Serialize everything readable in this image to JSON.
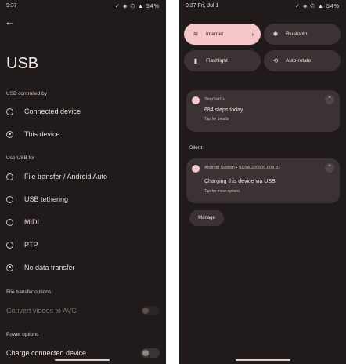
{
  "left_panel": {
    "status_time": "9:37",
    "status_icons": "✓ ◈ ✆ ▲ 54%",
    "back_icon": "arrow-back-icon",
    "page_title": "USB",
    "usb_controlled_by_heading": "USB controlled by",
    "controlled_options": [
      {
        "label": "Connected device",
        "selected": false
      },
      {
        "label": "This device",
        "selected": true
      }
    ],
    "use_usb_for_heading": "Use USB for",
    "usb_for_options": [
      {
        "label": "File transfer / Android Auto",
        "selected": false
      },
      {
        "label": "USB tethering",
        "selected": false
      },
      {
        "label": "MIDI",
        "selected": false
      },
      {
        "label": "PTP",
        "selected": false
      },
      {
        "label": "No data transfer",
        "selected": true
      }
    ],
    "file_transfer_options_heading": "File transfer options",
    "convert_videos_label": "Convert videos to AVC",
    "convert_videos_enabled": false,
    "power_options_heading": "Power options",
    "charge_connected_device_label": "Charge connected device",
    "charge_connected_device_on": false
  },
  "right_panel": {
    "status_time": "9:37 Fri, Jul 1",
    "status_icons": "✓ ◈ ✆ ▲ 54%",
    "tiles": [
      {
        "label": "Internet",
        "icon": "wifi-icon",
        "active": true,
        "has_chevron": true
      },
      {
        "label": "Bluetooth",
        "icon": "bluetooth-icon",
        "active": false
      },
      {
        "label": "Flashlight",
        "icon": "flashlight-icon",
        "active": false
      },
      {
        "label": "Auto-rotate",
        "icon": "auto-rotate-icon",
        "active": false
      }
    ],
    "notifications": {
      "stepsetgo": {
        "app": "StepSetGo",
        "title": "684 steps today",
        "subtitle": "Tap for details"
      },
      "silent_label": "Silent",
      "android_system": {
        "app": "Android System • SQ3A.220605.009.B1",
        "title": "Charging this device via USB",
        "subtitle": "Tap for more options"
      },
      "manage_label": "Manage"
    }
  }
}
